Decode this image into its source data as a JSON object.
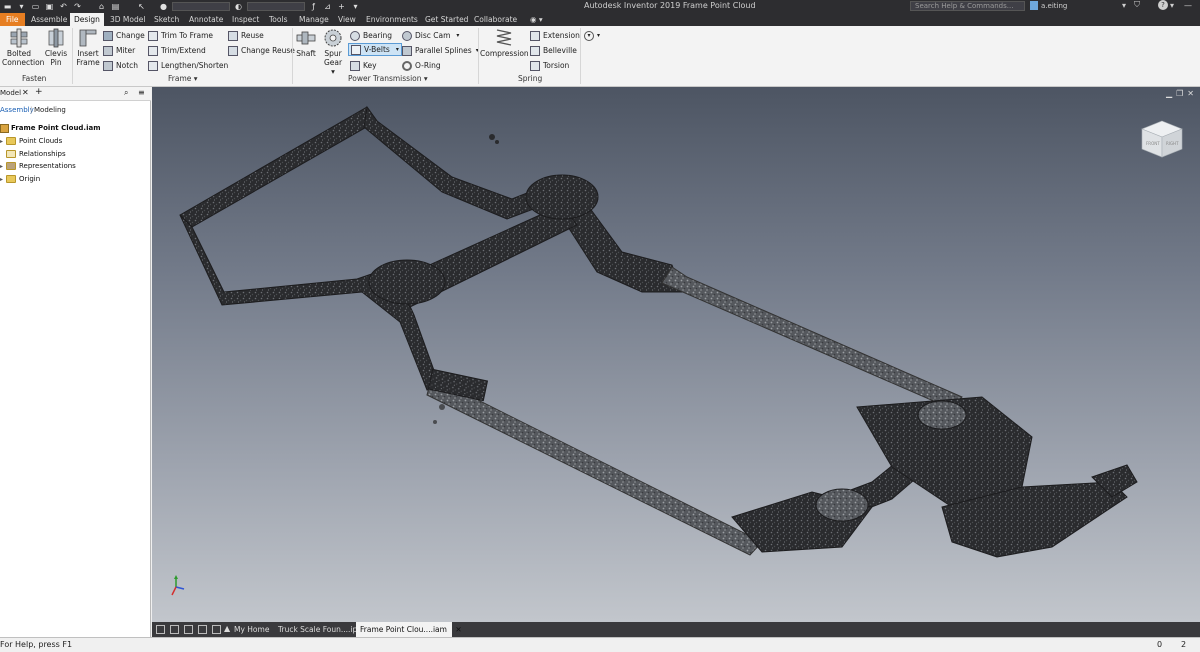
{
  "titlebar": {
    "app_title": "Autodesk Inventor 2019   Frame Point Cloud",
    "search_placeholder": "Search Help & Commands...",
    "user": "a.eiting",
    "help_label": "?"
  },
  "tabs": [
    {
      "label": "File"
    },
    {
      "label": "Assemble"
    },
    {
      "label": "Design"
    },
    {
      "label": "3D Model"
    },
    {
      "label": "Sketch"
    },
    {
      "label": "Annotate"
    },
    {
      "label": "Inspect"
    },
    {
      "label": "Tools"
    },
    {
      "label": "Manage"
    },
    {
      "label": "View"
    },
    {
      "label": "Environments"
    },
    {
      "label": "Get Started"
    },
    {
      "label": "Collaborate"
    }
  ],
  "ribbon": {
    "fasten": {
      "label": "Fasten",
      "bolted_line1": "Bolted",
      "bolted_line2": "Connection",
      "clevis_line1": "Clevis",
      "clevis_line2": "Pin"
    },
    "frame": {
      "label": "Frame",
      "insert_line1": "Insert",
      "insert_line2": "Frame",
      "change": "Change",
      "miter": "Miter",
      "notch": "Notch",
      "trim_to_frame": "Trim To Frame",
      "trim_extend": "Trim/Extend",
      "lengthen_shorten": "Lengthen/Shorten",
      "reuse": "Reuse",
      "change_reuse": "Change Reuse"
    },
    "power_transmission": {
      "label": "Power Transmission",
      "shaft": "Shaft",
      "spur_line1": "Spur",
      "spur_line2": "Gear",
      "bearing": "Bearing",
      "vbelts": "V-Belts",
      "key": "Key",
      "disc_cam": "Disc Cam",
      "parallel_splines": "Parallel Splines",
      "o_ring": "O-Ring"
    },
    "spring": {
      "label": "Spring",
      "compression": "Compression",
      "extension": "Extension",
      "belleville": "Belleville",
      "torsion": "Torsion"
    }
  },
  "browser": {
    "tab_model": "Model",
    "add_label": "+",
    "sub_assembly": "Assembly",
    "sub_modeling": "Modeling",
    "root": "Frame Point Cloud.iam",
    "items": [
      {
        "label": "Point Clouds"
      },
      {
        "label": "Relationships"
      },
      {
        "label": "Representations"
      },
      {
        "label": "Origin"
      }
    ]
  },
  "doc_tabs": [
    {
      "label": "My Home"
    },
    {
      "label": "Truck Scale Foun....ipt"
    },
    {
      "label": "Frame Point Clou....iam"
    }
  ],
  "status": {
    "text": "For Help, press F1",
    "count1": "0",
    "count2": "2"
  },
  "viewcube": {
    "face_left": "FRONT",
    "face_right": "RIGHT"
  },
  "colors": {
    "file_tab": "#e67e22",
    "titlebar": "#2d2d30",
    "ribbon": "#f3f3f3",
    "vbelts_highlight": "#cde3f5"
  }
}
